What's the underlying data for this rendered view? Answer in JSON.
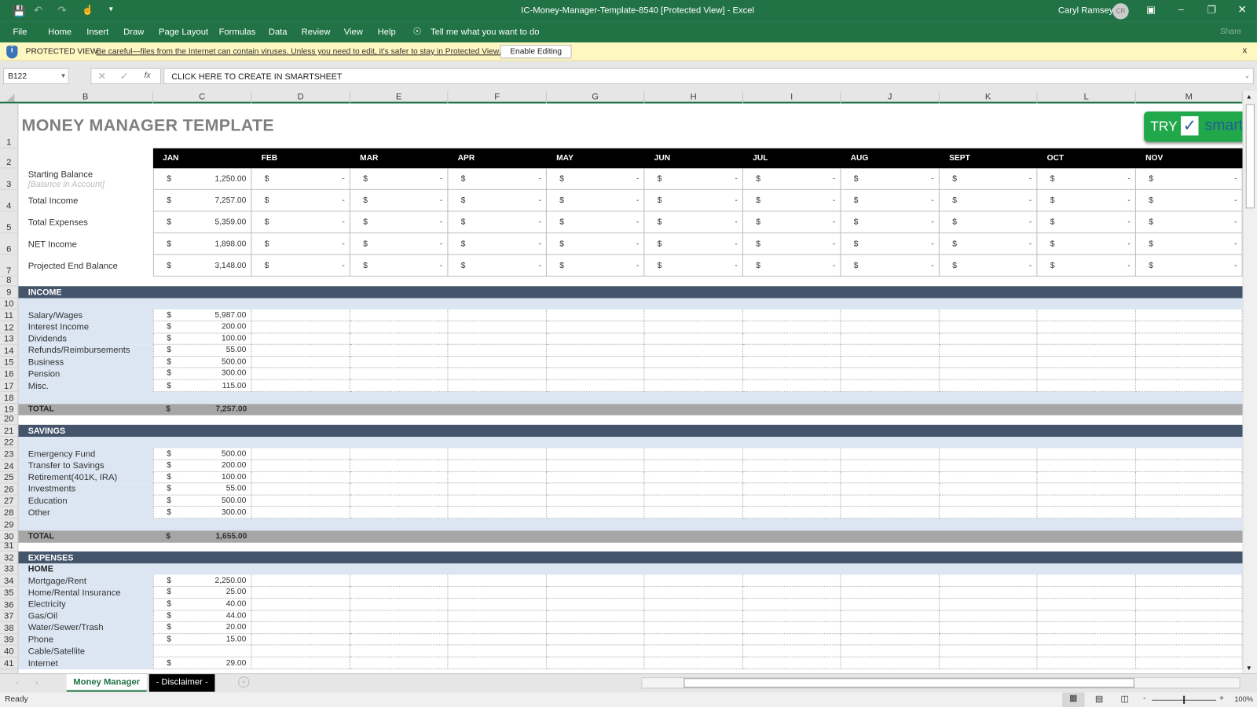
{
  "window": {
    "title": "IC-Money-Manager-Template-8540  [Protected View]  -  Excel",
    "user": "Caryl Ramsey",
    "initials": "CR"
  },
  "ribbon": {
    "tabs": [
      "File",
      "Home",
      "Insert",
      "Draw",
      "Page Layout",
      "Formulas",
      "Data",
      "Review",
      "View",
      "Help"
    ],
    "tell_me": "Tell me what you want to do",
    "share": "Share"
  },
  "protected": {
    "label": "PROTECTED VIEW",
    "message": "Be careful—files from the Internet can contain viruses. Unless you need to edit, it's safer to stay in Protected View.",
    "button": "Enable Editing",
    "close": "x"
  },
  "formula_bar": {
    "name_box": "B122",
    "formula": "CLICK HERE TO CREATE IN SMARTSHEET",
    "fx": "fx"
  },
  "columns": [
    "B",
    "C",
    "D",
    "E",
    "F",
    "G",
    "H",
    "I",
    "J",
    "K",
    "L",
    "M"
  ],
  "rows": [
    "1",
    "2",
    "3",
    "4",
    "5",
    "6",
    "7",
    "8",
    "9",
    "10",
    "11",
    "12",
    "13",
    "14",
    "15",
    "16",
    "17",
    "18",
    "19",
    "20",
    "21",
    "22",
    "23",
    "24",
    "25",
    "26",
    "27",
    "28",
    "29",
    "30",
    "31",
    "32",
    "33",
    "34",
    "35",
    "36",
    "37",
    "38",
    "39",
    "40",
    "41"
  ],
  "sheet": {
    "title": "MONEY MANAGER TEMPLATE",
    "banner": {
      "try": "TRY",
      "brand": "smartsheet",
      "brand_color": "#1f5c99",
      "bg": "#21a84a"
    },
    "currency": "$",
    "empty": "-",
    "months": [
      "JAN",
      "FEB",
      "MAR",
      "APR",
      "MAY",
      "JUN",
      "JUL",
      "AUG",
      "SEPT",
      "OCT",
      "NOV"
    ],
    "summary": [
      {
        "label": "Starting Balance",
        "sublabel": "[Balance in Account]",
        "jan": "1,250.00"
      },
      {
        "label": "Total Income",
        "jan": "7,257.00"
      },
      {
        "label": "Total Expenses",
        "jan": "5,359.00"
      },
      {
        "label": "NET Income",
        "jan": "1,898.00"
      },
      {
        "label": "Projected End Balance",
        "jan": "3,148.00"
      }
    ],
    "income": {
      "header": "INCOME",
      "items": [
        {
          "label": "Salary/Wages",
          "value": "5,987.00"
        },
        {
          "label": "Interest Income",
          "value": "200.00"
        },
        {
          "label": "Dividends",
          "value": "100.00"
        },
        {
          "label": "Refunds/Reimbursements",
          "value": "55.00"
        },
        {
          "label": "Business",
          "value": "500.00"
        },
        {
          "label": "Pension",
          "value": "300.00"
        },
        {
          "label": "Misc.",
          "value": "115.00"
        }
      ],
      "total_label": "TOTAL",
      "total_value": "7,257.00"
    },
    "savings": {
      "header": "SAVINGS",
      "items": [
        {
          "label": "Emergency Fund",
          "value": "500.00"
        },
        {
          "label": "Transfer to Savings",
          "value": "200.00"
        },
        {
          "label": "Retirement(401K, IRA)",
          "value": "100.00"
        },
        {
          "label": "Investments",
          "value": "55.00"
        },
        {
          "label": "Education",
          "value": "500.00"
        },
        {
          "label": "Other",
          "value": "300.00"
        }
      ],
      "total_label": "TOTAL",
      "total_value": "1,655.00"
    },
    "expenses": {
      "header": "EXPENSES",
      "subheader": "HOME",
      "items": [
        {
          "label": "Mortgage/Rent",
          "value": "2,250.00"
        },
        {
          "label": "Home/Rental Insurance",
          "value": "25.00"
        },
        {
          "label": "Electricity",
          "value": "40.00"
        },
        {
          "label": "Gas/Oil",
          "value": "44.00"
        },
        {
          "label": "Water/Sewer/Trash",
          "value": "20.00"
        },
        {
          "label": "Phone",
          "value": "15.00"
        },
        {
          "label": "Cable/Satellite"
        },
        {
          "label": "Internet",
          "value": "29.00"
        }
      ]
    }
  },
  "sheet_tabs": [
    "Money Manager",
    "- Disclaimer -"
  ],
  "status": {
    "text": "Ready",
    "zoom": "100%"
  },
  "colors": {
    "excel_green": "#217346",
    "band": "#44546a",
    "light_band": "#dce6f2",
    "total": "#a6a6a6",
    "protected_bg": "#fff7c0"
  }
}
